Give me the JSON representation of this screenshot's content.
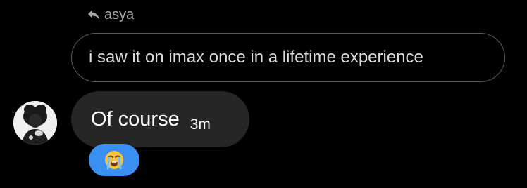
{
  "reply": {
    "icon": "reply-arrow-icon",
    "author": "asya",
    "quoted_text": "i saw it on imax once in a lifetime experience"
  },
  "message": {
    "avatar_icon": "user-avatar",
    "text": "Of course",
    "time": "3m"
  },
  "reaction": {
    "icon": "loudly-crying-face-emoji",
    "color": "#3b8ef2"
  },
  "colors": {
    "background": "#000000",
    "bubble": "#262626",
    "quoted_border": "#5a5a5a",
    "secondary_text": "#a8a8a8"
  }
}
